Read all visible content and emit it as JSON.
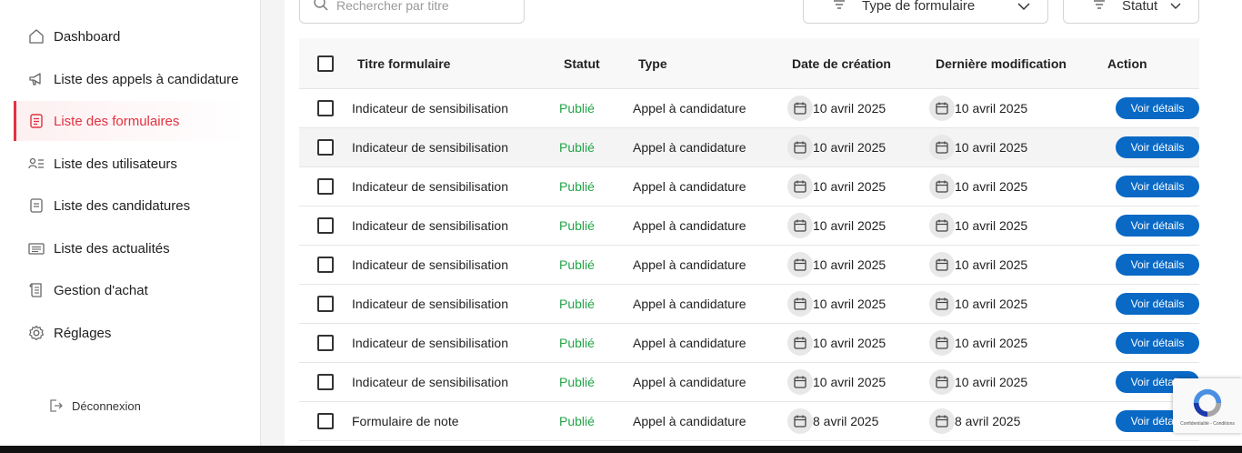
{
  "sidebar": {
    "items": [
      {
        "label": "Dashboard",
        "icon": "home-icon"
      },
      {
        "label": "Liste des appels à candidature",
        "icon": "megaphone-icon"
      },
      {
        "label": "Liste des formulaires",
        "icon": "form-icon",
        "active": true
      },
      {
        "label": "Liste des utilisateurs",
        "icon": "users-list-icon"
      },
      {
        "label": "Liste des candidatures",
        "icon": "document-icon"
      },
      {
        "label": "Liste des actualités",
        "icon": "news-icon"
      },
      {
        "label": "Gestion d'achat",
        "icon": "receipt-icon"
      },
      {
        "label": "Réglages",
        "icon": "gear-icon"
      }
    ],
    "logout_label": "Déconnexion"
  },
  "toolbar": {
    "search_placeholder": "Rechercher par titre",
    "type_filter_label": "Type de formulaire",
    "status_filter_label": "Statut"
  },
  "table": {
    "columns": [
      "Titre formulaire",
      "Statut",
      "Type",
      "Date de création",
      "Dernière modification",
      "Action"
    ],
    "rows": [
      {
        "title": "Indicateur de sensibilisation",
        "status": "Publié",
        "type": "Appel à candidature",
        "created": "10 avril 2025",
        "modified": "10 avril 2025",
        "action": "Voir détails"
      },
      {
        "title": "Indicateur de sensibilisation",
        "status": "Publié",
        "type": "Appel à candidature",
        "created": "10 avril 2025",
        "modified": "10 avril 2025",
        "action": "Voir détails"
      },
      {
        "title": "Indicateur de sensibilisation",
        "status": "Publié",
        "type": "Appel à candidature",
        "created": "10 avril 2025",
        "modified": "10 avril 2025",
        "action": "Voir détails"
      },
      {
        "title": "Indicateur de sensibilisation",
        "status": "Publié",
        "type": "Appel à candidature",
        "created": "10 avril 2025",
        "modified": "10 avril 2025",
        "action": "Voir détails"
      },
      {
        "title": "Indicateur de sensibilisation",
        "status": "Publié",
        "type": "Appel à candidature",
        "created": "10 avril 2025",
        "modified": "10 avril 2025",
        "action": "Voir détails"
      },
      {
        "title": "Indicateur de sensibilisation",
        "status": "Publié",
        "type": "Appel à candidature",
        "created": "10 avril 2025",
        "modified": "10 avril 2025",
        "action": "Voir détails"
      },
      {
        "title": "Indicateur de sensibilisation",
        "status": "Publié",
        "type": "Appel à candidature",
        "created": "10 avril 2025",
        "modified": "10 avril 2025",
        "action": "Voir détails"
      },
      {
        "title": "Indicateur de sensibilisation",
        "status": "Publié",
        "type": "Appel à candidature",
        "created": "10 avril 2025",
        "modified": "10 avril 2025",
        "action": "Voir détails"
      },
      {
        "title": "Formulaire de note",
        "status": "Publié",
        "type": "Appel à candidature",
        "created": "8 avril 2025",
        "modified": "8 avril 2025",
        "action": "Voir détails"
      }
    ]
  },
  "recaptcha": {
    "text": "Confidentialité - Conditions"
  },
  "colors": {
    "accent": "#e4313f",
    "primary_button": "#0969c5",
    "status_published": "#22a447"
  }
}
